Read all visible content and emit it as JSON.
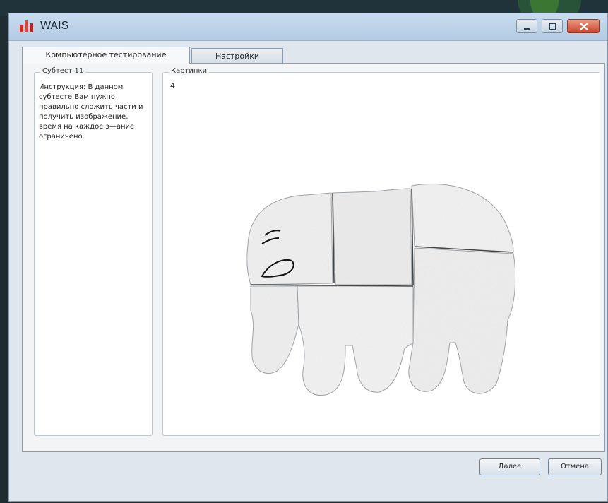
{
  "window": {
    "title": "WAIS",
    "app_icon": "bar-chart-icon",
    "controls": [
      "minimize-icon",
      "maximize-icon",
      "close-icon"
    ]
  },
  "tabs": [
    {
      "label": "Компьютерное тестирование",
      "active": true
    },
    {
      "label": "Настройки",
      "active": false
    }
  ],
  "subtest": {
    "legend": "Субтест 11",
    "instruction": "Инструкция: В данном субтесте Вам нужно правильно сложить части и получить изображение, время на каждое з—ание ограничено."
  },
  "pictures": {
    "legend": "Картинки",
    "number": "4",
    "image": "elephant-puzzle"
  },
  "buttons": {
    "next": "Далее",
    "cancel": "Отмена"
  },
  "colors": {
    "titlebar": "#c9dcef",
    "window_bg": "#dfe6ee",
    "close_button": "#c9482d",
    "icon_red": "#c8302a"
  }
}
